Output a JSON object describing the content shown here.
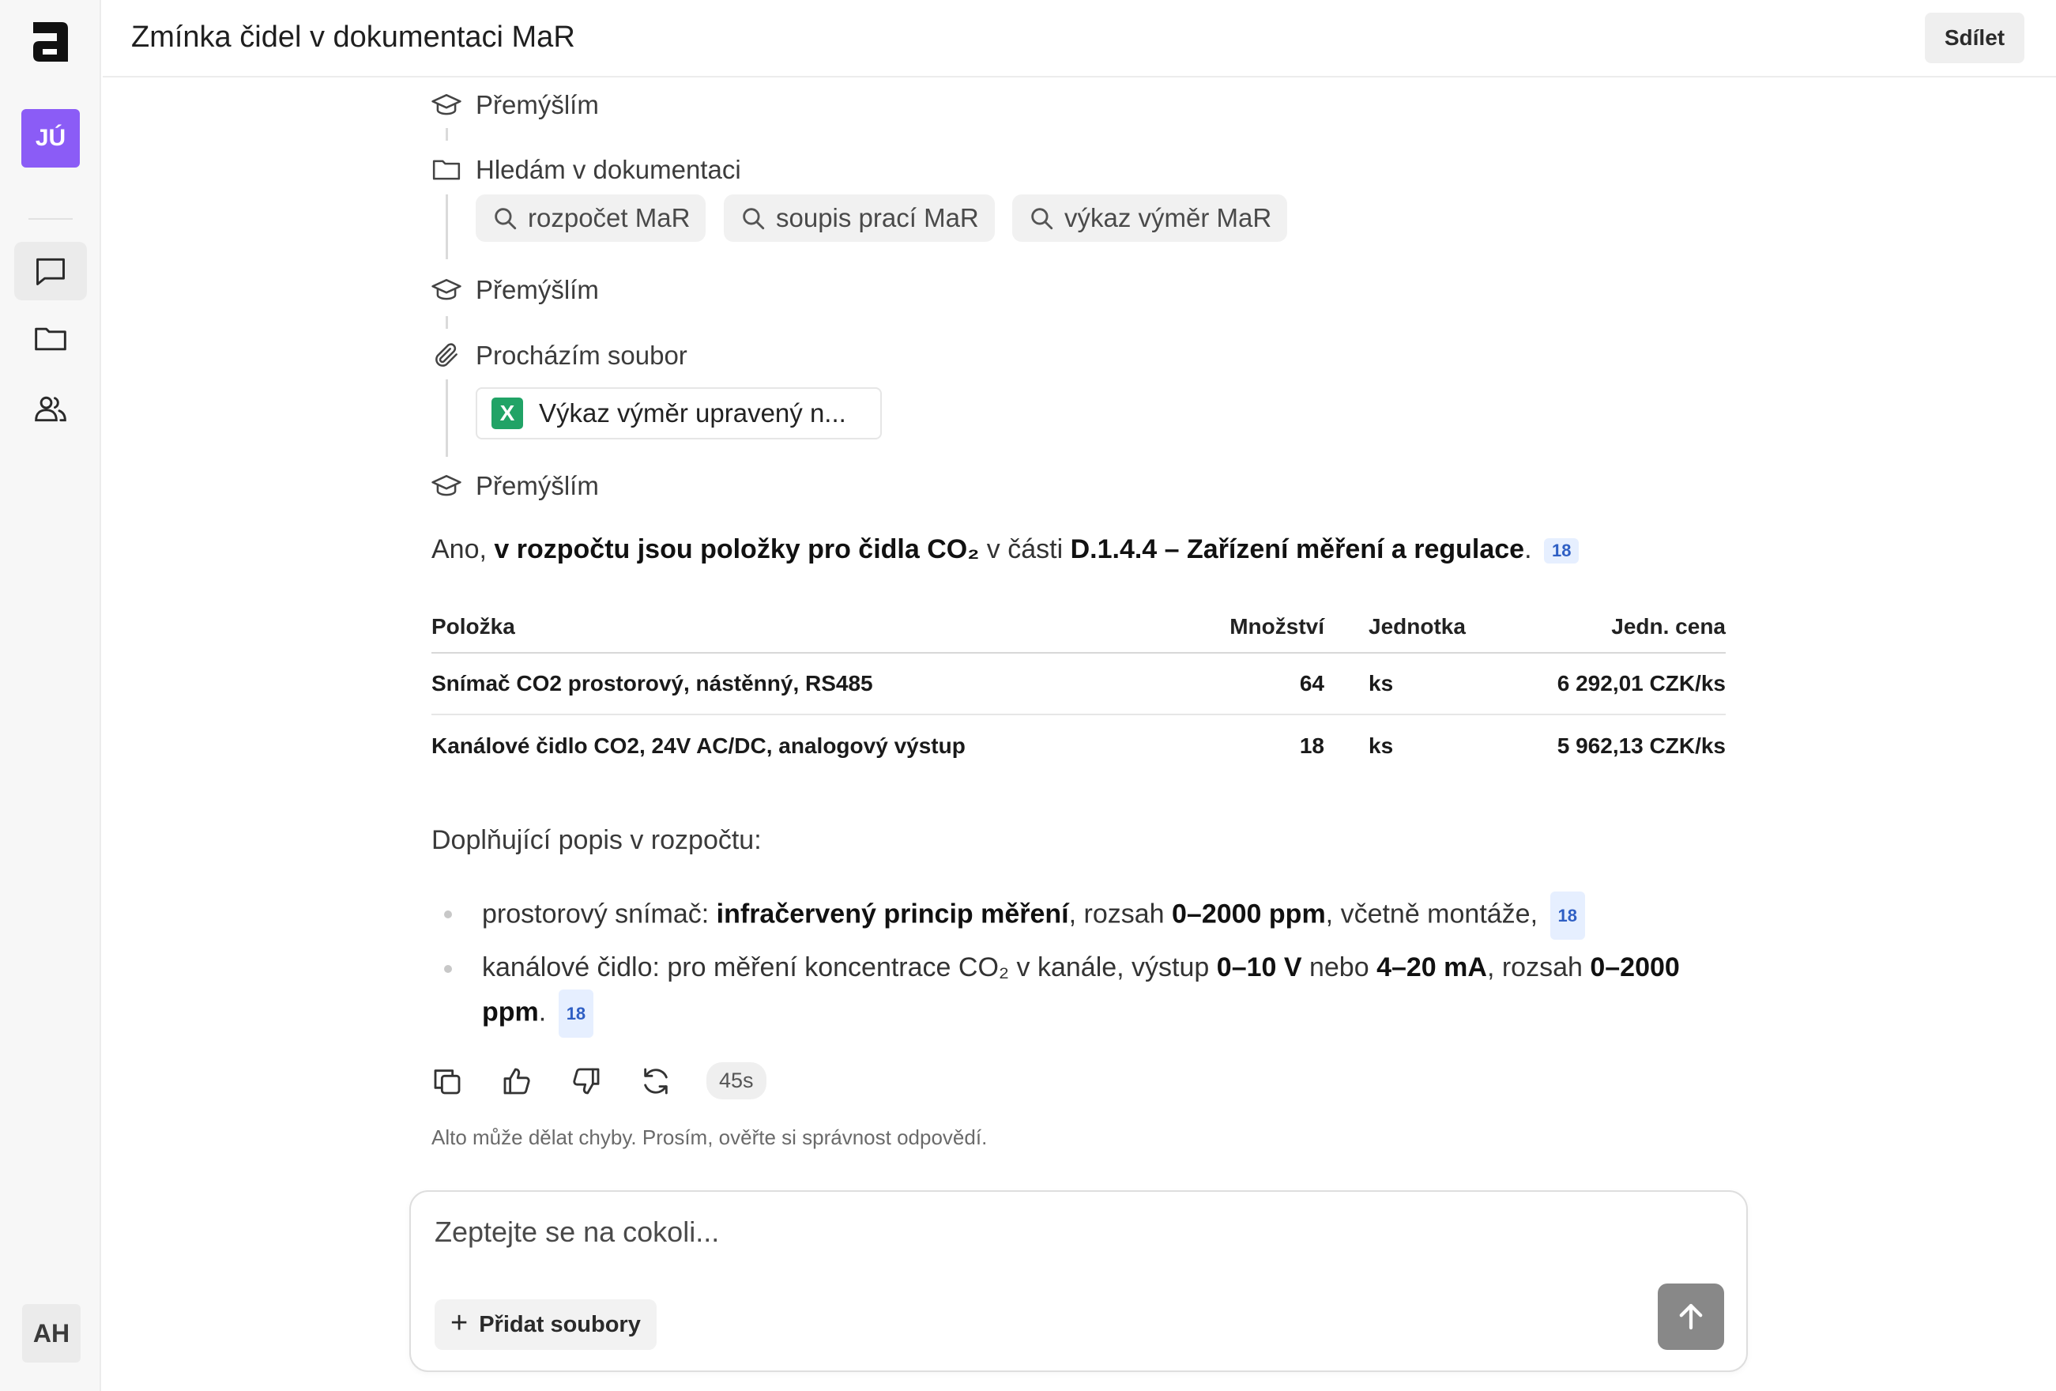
{
  "app": {
    "logo_icon": "alto-a-logo",
    "user_initials": "JÚ",
    "user_color": "#8b5cf6",
    "account_initials": "AH"
  },
  "sidebar": {
    "nav": [
      {
        "name": "chat",
        "icon": "chat-bubble-icon",
        "active": true
      },
      {
        "name": "files",
        "icon": "folder-icon",
        "active": false
      },
      {
        "name": "users",
        "icon": "users-icon",
        "active": false
      }
    ]
  },
  "header": {
    "title": "Zmínka čidel v dokumentaci MaR",
    "share_label": "Sdílet"
  },
  "steps": {
    "thinking_label": "Přemýšlím",
    "search_label": "Hledám v dokumentaci",
    "search_queries": [
      "rozpočet MaR",
      "soupis prací MaR",
      "výkaz výměr MaR"
    ],
    "browse_label": "Procházím soubor",
    "file_name": "Výkaz výměr upravený n...",
    "file_icon_letter": "X"
  },
  "answer": {
    "intro_prefix": "Ano, ",
    "intro_bold": "v rozpočtu jsou položky pro čidla CO₂",
    "intro_middle": " v části ",
    "intro_section": "D.1.4.4 – Zařízení měření a regulace",
    "intro_suffix": ".",
    "citation": "18",
    "table": {
      "headers": [
        "Položka",
        "Množství",
        "Jednotka",
        "Jedn. cena"
      ],
      "rows": [
        [
          "Snímač CO2 prostorový, nástěnný, RS485",
          "64",
          "ks",
          "6 292,01 CZK/ks"
        ],
        [
          "Kanálové čidlo CO2, 24V AC/DC, analogový výstup",
          "18",
          "ks",
          "5 962,13 CZK/ks"
        ]
      ]
    },
    "subheading": "Doplňující popis v rozpočtu:",
    "bullet1": {
      "p1": "prostorový snímač: ",
      "b1": "infračervený princip měření",
      "p2": ", rozsah ",
      "b2": "0–2000 ppm",
      "p3": ", včetně montáže,",
      "cite": "18"
    },
    "bullet2": {
      "p1": "kanálové čidlo: pro měření koncentrace CO₂ v kanále, výstup ",
      "b1": "0–10 V",
      "p2": " nebo ",
      "b2": "4–20 mA",
      "p3": ", rozsah ",
      "b3": "0–2000 ppm",
      "p4": ".",
      "cite": "18"
    }
  },
  "message_actions": {
    "icons": [
      "copy-icon",
      "thumbs-up-icon",
      "thumbs-down-icon",
      "regenerate-icon"
    ],
    "duration": "45s"
  },
  "disclaimer": "Alto může dělat chyby. Prosím, ověřte si správnost odpovědí.",
  "composer": {
    "placeholder": "Zeptejte se na cokoli...",
    "add_files_label": "Přidat soubory",
    "send_icon": "arrow-up-icon"
  }
}
